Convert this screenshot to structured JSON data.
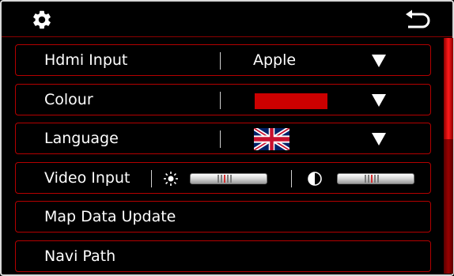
{
  "header": {
    "settings_icon": "gear-icon",
    "back_icon": "back-arrow-icon"
  },
  "rows": [
    {
      "label": "Hdmi Input",
      "value": "Apple"
    },
    {
      "label": "Colour",
      "value_color": "#cc0000"
    },
    {
      "label": "Language",
      "value_icon": "uk-flag-icon"
    },
    {
      "label": "Video Input",
      "brightness_icon": "brightness-icon",
      "contrast_icon": "contrast-icon"
    },
    {
      "label": "Map Data Update"
    },
    {
      "label": "Navi Path"
    }
  ],
  "colors": {
    "background": "#000000",
    "accent": "#b40000",
    "text": "#ffffff"
  }
}
